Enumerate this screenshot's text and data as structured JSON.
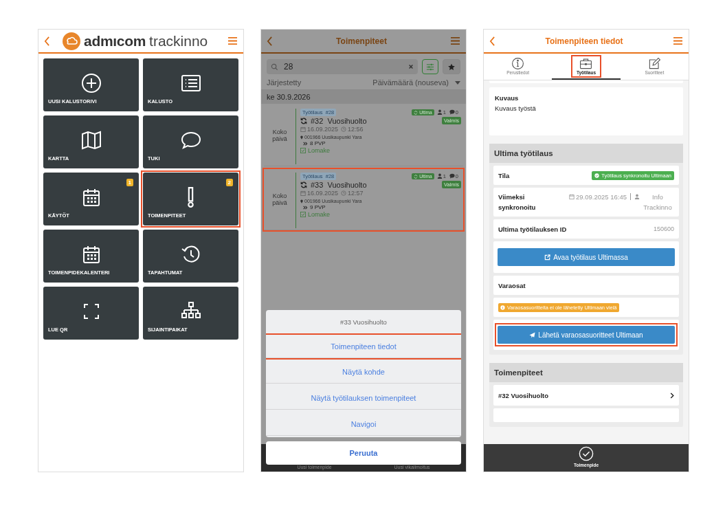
{
  "home": {
    "logo": [
      "admıcom",
      "trackinno"
    ],
    "tiles": [
      {
        "label": "UUSI KALUSTORIVI",
        "highlighted": false
      },
      {
        "label": "KALUSTO",
        "highlighted": false
      },
      {
        "label": "KARTTA",
        "highlighted": false
      },
      {
        "label": "TUKI",
        "highlighted": false
      },
      {
        "label": "KÄYTÖT",
        "badge": "1",
        "highlighted": false
      },
      {
        "label": "TOIMENPITEET",
        "badge": "2",
        "highlighted": true
      },
      {
        "label": "TOIMENPIDEKALENTERI",
        "highlighted": false
      },
      {
        "label": "TAPAHTUMAT",
        "highlighted": false
      },
      {
        "label": "LUE QR",
        "highlighted": false
      },
      {
        "label": "SIJAINTIPAIKAT",
        "highlighted": false
      }
    ]
  },
  "list": {
    "title": "Toimenpiteet",
    "search": {
      "value": "28"
    },
    "sort": {
      "label": "Järjestetty",
      "value": "Päivämäärä (nouseva)"
    },
    "date_header": "ke 30.9.2026",
    "items": [
      {
        "time": "Koko päivä",
        "order": "Työtilaus  #28",
        "source": "Ultima",
        "people": "1",
        "comments": "0",
        "status": "Valmis",
        "title": "#32  Vuosihuolto",
        "date": "16.09.2025",
        "clock": "12:56",
        "location": "001966 Uusikaupunki Yara",
        "pvp": "8 PVP",
        "form": "Lomake",
        "highlighted": false
      },
      {
        "time": "Koko päivä",
        "order": "Työtilaus  #28",
        "source": "Ultima",
        "people": "1",
        "comments": "0",
        "status": "Valmis",
        "title": "#33  Vuosihuolto",
        "date": "16.09.2025",
        "clock": "12:57",
        "location": "001966 Uusikaupunki Yara",
        "pvp": "9 PVP",
        "form": "Lomake",
        "highlighted": true
      }
    ],
    "sheet": {
      "title": "#33 Vuosihuolto",
      "actions": [
        {
          "label": "Toimenpiteen tiedot",
          "highlighted": true
        },
        {
          "label": "Näytä kohde",
          "highlighted": false
        },
        {
          "label": "Näytä työtilauksen toimenpiteet",
          "highlighted": false
        },
        {
          "label": "Navigoi",
          "highlighted": false
        }
      ],
      "cancel": "Peruuta"
    },
    "tabbar": [
      "Uusi toimenpide",
      "Uusi vikailmoitus"
    ]
  },
  "details": {
    "title": "Toimenpiteen tiedot",
    "tabs": [
      {
        "label": "Perustiedot",
        "selected": false,
        "highlighted": false
      },
      {
        "label": "Työtilaus",
        "selected": true,
        "highlighted": true
      },
      {
        "label": "Suoritteet",
        "selected": false,
        "highlighted": false
      }
    ],
    "description": {
      "label": "Kuvaus",
      "text": "Kuvaus työstä"
    },
    "ultima": {
      "heading": "Ultima työtilaus",
      "status_label": "Tila",
      "status": "Työtilaus synkronoitu Ultimaan",
      "synced_label": "Viimeksi synkronoitu",
      "synced_date": "29.09.2025 16:45",
      "synced_by": "Info Trackinno",
      "id_label": "Ultima työtilauksen ID",
      "id": "150600",
      "open_button": "Avaa työtilaus Ultimassa",
      "parts_label": "Varaosat",
      "parts_warning": "Varaosasuoritteita ei ole lähetetty Ultimaan vielä",
      "send_button": {
        "label": "Lähetä varaosasuoritteet Ultimaan",
        "highlighted": true
      }
    },
    "operations": {
      "heading": "Toimenpiteet",
      "items": [
        {
          "label": "#32 Vuosihuolto"
        }
      ]
    },
    "bottom": {
      "label": "Toimenpide"
    }
  }
}
